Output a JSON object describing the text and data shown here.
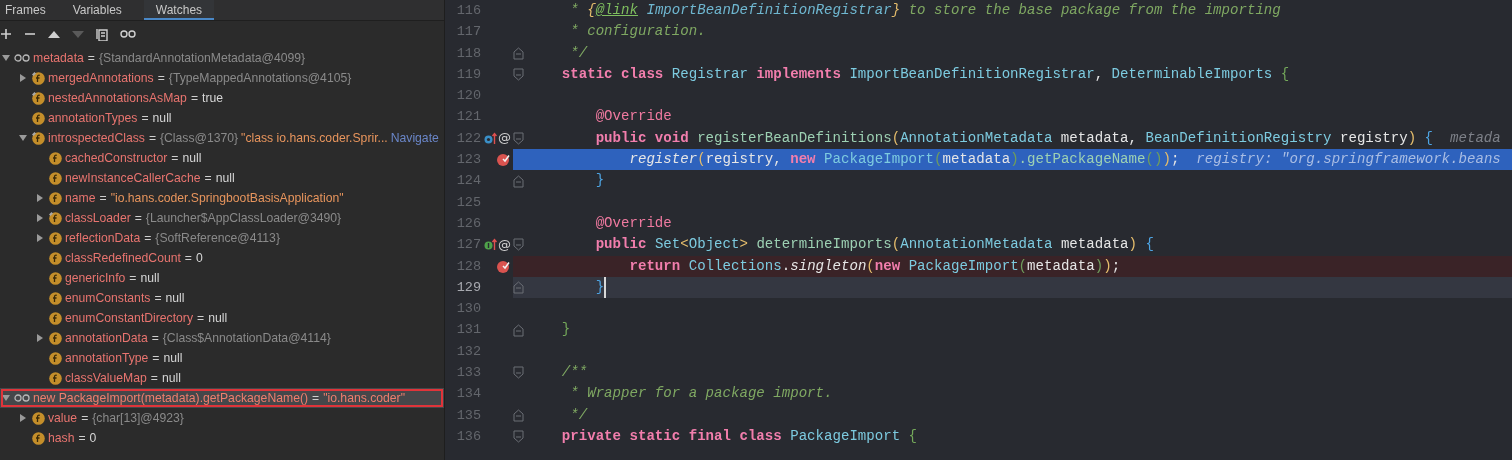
{
  "debugger": {
    "tabs": [
      {
        "label": "Frames",
        "selected": false
      },
      {
        "label": "Variables",
        "selected": false
      },
      {
        "label": "Watches",
        "selected": true
      }
    ],
    "toolbar": [
      {
        "kind": "add",
        "disabled": false
      },
      {
        "kind": "remove",
        "disabled": false
      },
      {
        "kind": "up",
        "disabled": false
      },
      {
        "kind": "down",
        "disabled": true
      },
      {
        "kind": "copy",
        "disabled": false
      },
      {
        "kind": "watch",
        "disabled": false
      }
    ],
    "tree": [
      {
        "kind": "watch",
        "name": "metadata",
        "eq": "=",
        "value": [
          {
            "kind": "ref",
            "text": "{StandardAnnotationMetadata@4099}"
          }
        ],
        "expanded": true,
        "selected": false,
        "children": [
          {
            "kind": "field",
            "final": true,
            "name": "mergedAnnotations",
            "eq": "=",
            "value": [
              {
                "kind": "ref",
                "text": "{TypeMappedAnnotations@4105}"
              }
            ],
            "expanded": false,
            "selected": false
          },
          {
            "kind": "field",
            "final": true,
            "name": "nestedAnnotationsAsMap",
            "eq": "=",
            "value": [
              {
                "kind": "literal",
                "text": "true"
              }
            ],
            "selected": false
          },
          {
            "kind": "field",
            "final": false,
            "name": "annotationTypes",
            "eq": "=",
            "value": [
              {
                "kind": "literal",
                "text": "null"
              }
            ],
            "selected": false
          },
          {
            "kind": "field",
            "final": true,
            "name": "introspectedClass",
            "eq": "=",
            "value": [
              {
                "kind": "ref",
                "text": "{Class@1370}"
              },
              {
                "kind": "string",
                "text": "\"class io.hans.coder.Sprir..."
              }
            ],
            "link": "Navigate",
            "expanded": true,
            "selected": false,
            "children": [
              {
                "kind": "field",
                "final": false,
                "name": "cachedConstructor",
                "eq": "=",
                "value": [
                  {
                    "kind": "literal",
                    "text": "null"
                  }
                ],
                "selected": false
              },
              {
                "kind": "field",
                "final": false,
                "name": "newInstanceCallerCache",
                "eq": "=",
                "value": [
                  {
                    "kind": "literal",
                    "text": "null"
                  }
                ],
                "selected": false
              },
              {
                "kind": "field",
                "final": false,
                "name": "name",
                "eq": "=",
                "value": [
                  {
                    "kind": "string",
                    "text": "\"io.hans.coder.SpringbootBasisApplication\""
                  }
                ],
                "expanded": false,
                "selected": false
              },
              {
                "kind": "field",
                "final": true,
                "name": "classLoader",
                "eq": "=",
                "value": [
                  {
                    "kind": "ref",
                    "text": "{Launcher$AppClassLoader@3490}"
                  }
                ],
                "expanded": false,
                "selected": false
              },
              {
                "kind": "field",
                "final": false,
                "name": "reflectionData",
                "eq": "=",
                "value": [
                  {
                    "kind": "ref",
                    "text": "{SoftReference@4113}"
                  }
                ],
                "expanded": false,
                "selected": false
              },
              {
                "kind": "field",
                "final": false,
                "name": "classRedefinedCount",
                "eq": "=",
                "value": [
                  {
                    "kind": "literal",
                    "text": "0"
                  }
                ],
                "selected": false
              },
              {
                "kind": "field",
                "final": false,
                "name": "genericInfo",
                "eq": "=",
                "value": [
                  {
                    "kind": "literal",
                    "text": "null"
                  }
                ],
                "selected": false
              },
              {
                "kind": "field",
                "final": false,
                "name": "enumConstants",
                "eq": "=",
                "value": [
                  {
                    "kind": "literal",
                    "text": "null"
                  }
                ],
                "selected": false
              },
              {
                "kind": "field",
                "final": false,
                "name": "enumConstantDirectory",
                "eq": "=",
                "value": [
                  {
                    "kind": "literal",
                    "text": "null"
                  }
                ],
                "selected": false
              },
              {
                "kind": "field",
                "final": false,
                "name": "annotationData",
                "eq": "=",
                "value": [
                  {
                    "kind": "ref",
                    "text": "{Class$AnnotationData@4114}"
                  }
                ],
                "expanded": false,
                "selected": false
              },
              {
                "kind": "field",
                "final": false,
                "name": "annotationType",
                "eq": "=",
                "value": [
                  {
                    "kind": "literal",
                    "text": "null"
                  }
                ],
                "selected": false
              },
              {
                "kind": "field",
                "final": false,
                "name": "classValueMap",
                "eq": "=",
                "value": [
                  {
                    "kind": "literal",
                    "text": "null"
                  }
                ],
                "selected": false
              }
            ]
          }
        ]
      },
      {
        "kind": "watch",
        "name": "new PackageImport(metadata).getPackageName()",
        "eq": "=",
        "value": [
          {
            "kind": "string",
            "text": "\"io.hans.coder\""
          }
        ],
        "expanded": true,
        "selected": true,
        "outlined": true,
        "children": [
          {
            "kind": "field",
            "final": false,
            "name": "value",
            "eq": "=",
            "value": [
              {
                "kind": "ref",
                "text": "{char[13]@4923}"
              }
            ],
            "expanded": false,
            "selected": false
          },
          {
            "kind": "field",
            "final": false,
            "name": "hash",
            "eq": "=",
            "value": [
              {
                "kind": "literal",
                "text": "0"
              }
            ],
            "selected": false
          }
        ]
      }
    ]
  },
  "editor": {
    "lines": [
      {
        "number": "116",
        "tokens": [
          {
            "kind": "comment",
            "t": "     * "
          },
          {
            "kind": "docbrace",
            "t": "{"
          },
          {
            "kind": "doctag",
            "t": "@link"
          },
          {
            "kind": "docref",
            "t": " ImportBeanDefinitionRegistrar"
          },
          {
            "kind": "docbrace",
            "t": "}"
          },
          {
            "kind": "comment",
            "t": " to store the base package from the importing"
          }
        ]
      },
      {
        "number": "117",
        "tokens": [
          {
            "kind": "comment",
            "t": "     * configuration."
          }
        ]
      },
      {
        "number": "118",
        "fold_end": true,
        "tokens": [
          {
            "kind": "comment",
            "t": "     */"
          }
        ]
      },
      {
        "number": "119",
        "fold_start": true,
        "tokens": [
          {
            "kind": "kw",
            "t": "    static class "
          },
          {
            "kind": "type",
            "t": "Registrar "
          },
          {
            "kind": "kw",
            "t": "implements "
          },
          {
            "kind": "type",
            "t": "ImportBeanDefinitionRegistrar"
          },
          {
            "kind": "plain",
            "t": ", "
          },
          {
            "kind": "type",
            "t": "DeterminableImports "
          },
          {
            "kind": "brace_green",
            "t": "{"
          }
        ]
      },
      {
        "number": "120"
      },
      {
        "number": "121",
        "tokens": [
          {
            "kind": "ann",
            "t": "        @Override"
          }
        ]
      },
      {
        "number": "122",
        "marker": {
          "kind": "overrides"
        },
        "gutter_text": "@",
        "fold_start": true,
        "tokens": [
          {
            "kind": "kw",
            "t": "        public void "
          },
          {
            "kind": "fn",
            "t": "registerBeanDefinitions"
          },
          {
            "kind": "paren",
            "t": "("
          },
          {
            "kind": "type",
            "t": "AnnotationMetadata "
          },
          {
            "kind": "plain",
            "t": "metadata, "
          },
          {
            "kind": "type",
            "t": "BeanDefinitionRegistry "
          },
          {
            "kind": "plain",
            "t": "registry"
          },
          {
            "kind": "paren",
            "t": ")"
          },
          {
            "kind": "brace_blue",
            "t": " {"
          }
        ],
        "hint": "metada"
      },
      {
        "number": "123",
        "execution_point": true,
        "breakpoint": true,
        "tokens": [
          {
            "kind": "call",
            "t": "            register"
          },
          {
            "kind": "paren",
            "t": "("
          },
          {
            "kind": "plain",
            "t": "registry, "
          },
          {
            "kind": "kw",
            "t": "new "
          },
          {
            "kind": "type",
            "t": "PackageImport"
          },
          {
            "kind": "paren2",
            "t": "("
          },
          {
            "kind": "plain",
            "t": "metadata"
          },
          {
            "kind": "paren2",
            "t": ")"
          },
          {
            "kind": "fn",
            "t": ".getPackageName"
          },
          {
            "kind": "paren2",
            "t": "()"
          },
          {
            "kind": "paren",
            "t": ")"
          },
          {
            "kind": "plain",
            "t": ";"
          }
        ],
        "hint": "registry: \"org.springframework.beans"
      },
      {
        "number": "124",
        "fold_end": true,
        "tokens": [
          {
            "kind": "brace_blue",
            "t": "        }"
          }
        ]
      },
      {
        "number": "125"
      },
      {
        "number": "126",
        "tokens": [
          {
            "kind": "ann",
            "t": "        @Override"
          }
        ]
      },
      {
        "number": "127",
        "marker": {
          "kind": "implements"
        },
        "gutter_text": "@",
        "fold_start": true,
        "tokens": [
          {
            "kind": "kw",
            "t": "        public "
          },
          {
            "kind": "type",
            "t": "Set"
          },
          {
            "kind": "paren",
            "t": "<"
          },
          {
            "kind": "type",
            "t": "Object"
          },
          {
            "kind": "paren",
            "t": ">"
          },
          {
            "kind": "fn",
            "t": " determineImports"
          },
          {
            "kind": "paren",
            "t": "("
          },
          {
            "kind": "type",
            "t": "AnnotationMetadata "
          },
          {
            "kind": "plain",
            "t": "metadata"
          },
          {
            "kind": "paren",
            "t": ") "
          },
          {
            "kind": "brace_match",
            "t": "{"
          }
        ]
      },
      {
        "number": "128",
        "execution_point": false,
        "breakpoint": true,
        "tokens": [
          {
            "kind": "kw",
            "t": "            return "
          },
          {
            "kind": "type",
            "t": "Collections"
          },
          {
            "kind": "plain",
            "t": "."
          },
          {
            "kind": "call",
            "t": "singleton"
          },
          {
            "kind": "paren",
            "t": "("
          },
          {
            "kind": "kw",
            "t": "new "
          },
          {
            "kind": "type",
            "t": "PackageImport"
          },
          {
            "kind": "paren2",
            "t": "("
          },
          {
            "kind": "plain",
            "t": "metadata"
          },
          {
            "kind": "paren2",
            "t": ")"
          },
          {
            "kind": "paren",
            "t": ")"
          },
          {
            "kind": "plain",
            "t": ";"
          }
        ]
      },
      {
        "number": "129",
        "caret": true,
        "fold_end": true,
        "tokens": [
          {
            "kind": "brace_match",
            "t": "        }"
          }
        ]
      },
      {
        "number": "130"
      },
      {
        "number": "131",
        "fold_end": true,
        "tokens": [
          {
            "kind": "brace_green",
            "t": "    }"
          }
        ]
      },
      {
        "number": "132"
      },
      {
        "number": "133",
        "fold_start": true,
        "tokens": [
          {
            "kind": "comment",
            "t": "    /**"
          }
        ]
      },
      {
        "number": "134",
        "tokens": [
          {
            "kind": "comment",
            "t": "     * Wrapper for a package import."
          }
        ]
      },
      {
        "number": "135",
        "fold_end": true,
        "tokens": [
          {
            "kind": "comment",
            "t": "     */"
          }
        ]
      },
      {
        "number": "136",
        "fold_start": true,
        "tokens": [
          {
            "kind": "kw",
            "t": "    private static final class "
          },
          {
            "kind": "type",
            "t": "PackageImport "
          },
          {
            "kind": "brace_green",
            "t": "{"
          }
        ]
      }
    ]
  }
}
